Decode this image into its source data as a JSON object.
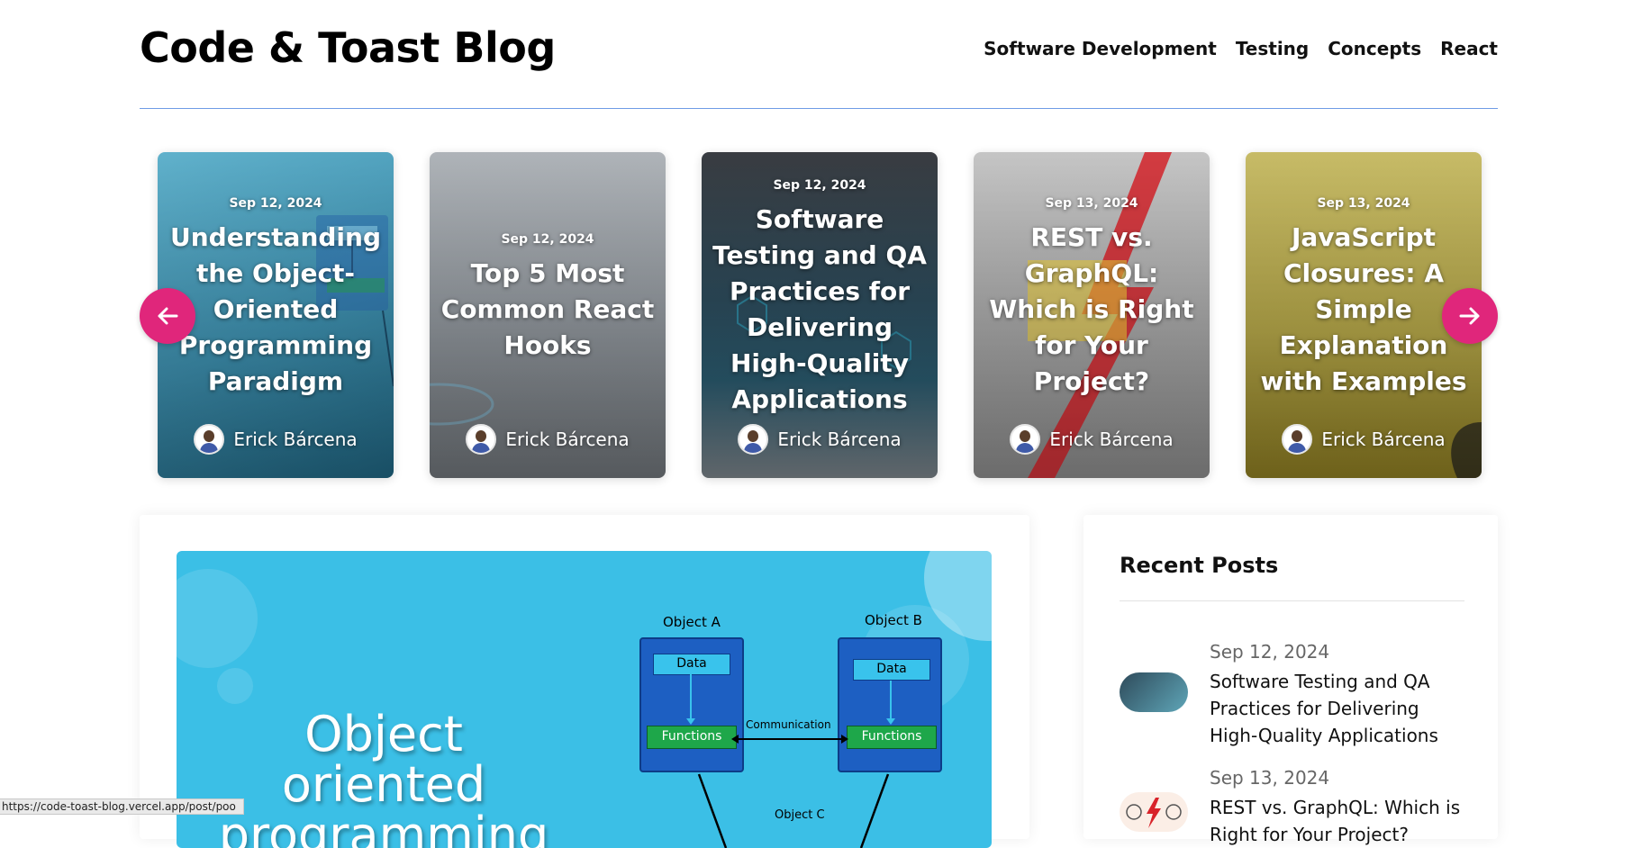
{
  "header": {
    "brand": "Code & Toast Blog",
    "nav": [
      "Software Development",
      "Testing",
      "Concepts",
      "React"
    ]
  },
  "carousel": {
    "prev_icon": "arrow-left-icon",
    "next_icon": "arrow-right-icon",
    "accent_color": "#e0267b",
    "cards": [
      {
        "date": "Sep 12, 2024",
        "title": "Understanding the Object-Oriented Programming Paradigm",
        "author": "Erick Bárcena"
      },
      {
        "date": "Sep 12, 2024",
        "title": "Top 5 Most Common React Hooks",
        "author": "Erick Bárcena"
      },
      {
        "date": "Sep 12, 2024",
        "title": "Software Testing and QA Practices for Delivering High-Quality Applications",
        "author": "Erick Bárcena"
      },
      {
        "date": "Sep 13, 2024",
        "title": "REST vs. GraphQL: Which is Right for Your Project?",
        "author": "Erick Bárcena"
      },
      {
        "date": "Sep 13, 2024",
        "title": "JavaScript Closures: A Simple Explanation with Examples",
        "author": "Erick Bárcena"
      }
    ]
  },
  "featured": {
    "hero_title": "Object oriented programming",
    "object_a": "Object A",
    "object_b": "Object B",
    "object_c": "Object C",
    "data_label": "Data",
    "functions_label": "Functions",
    "communication_label": "Communication"
  },
  "sidebar": {
    "title": "Recent Posts",
    "posts": [
      {
        "date": "Sep 12, 2024",
        "title": "Software Testing and QA Practices for Delivering High-Quality Applications"
      },
      {
        "date": "Sep 13, 2024",
        "title": "REST vs. GraphQL: Which is Right for Your Project?"
      }
    ]
  },
  "status_bar": {
    "url": "https://code-toast-blog.vercel.app/post/poo"
  }
}
